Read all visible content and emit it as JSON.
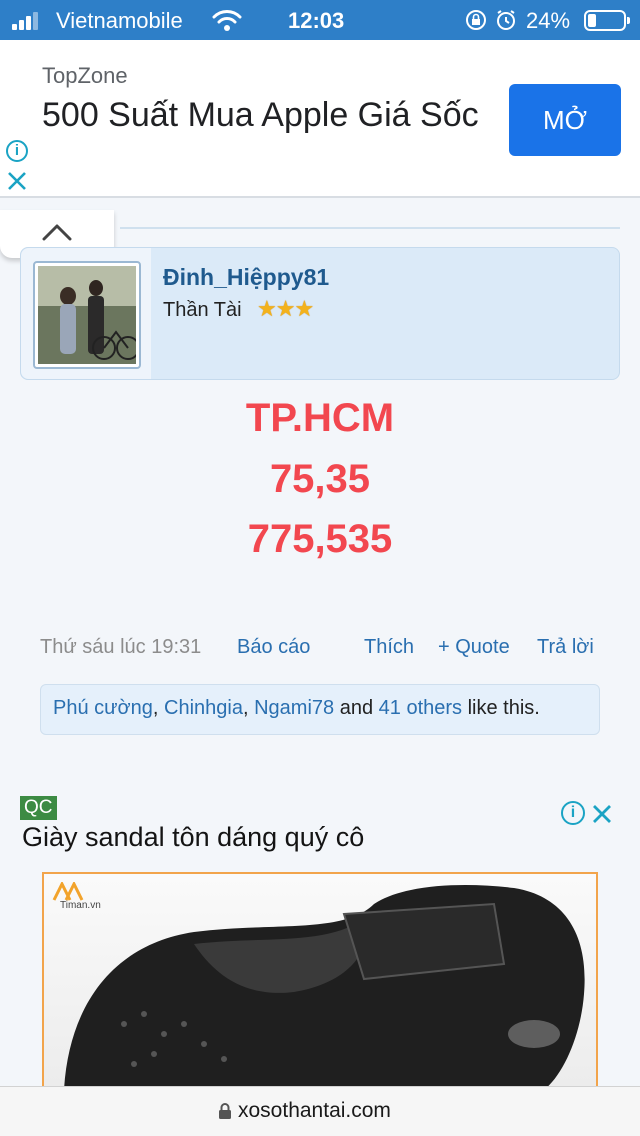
{
  "status_bar": {
    "carrier": "Vietnamobile",
    "time": "12:03",
    "battery": "24%"
  },
  "top_ad": {
    "advertiser": "TopZone",
    "headline": "500 Suất Mua Apple Giá Sốc",
    "cta": "MỞ"
  },
  "user": {
    "username": "Đinh_Hiệppy81",
    "rank": "Thần Tài",
    "stars": "★★★"
  },
  "post": {
    "lines": [
      "TP.HCM",
      "75,35",
      "775,535"
    ]
  },
  "post_actions": {
    "date": "Thứ sáu lúc 19:31",
    "report": "Báo cáo",
    "like": "Thích",
    "quote": "+ Quote",
    "reply": "Trả lời"
  },
  "likes": {
    "user1": "Phú cường",
    "user2": "Chinhgia",
    "user3": "Ngami78",
    "and_text": "and",
    "others": "41 others",
    "suffix": "like this."
  },
  "second_ad": {
    "badge": "QC",
    "title": "Giày sandal tôn dáng quý cô",
    "logo_text": "Timan.vn"
  },
  "url_bar": {
    "url": "xosothantai.com"
  },
  "colors": {
    "status_bar": "#2e7fc8",
    "cta_blue": "#1a73e8",
    "post_red": "#f2474f",
    "link_blue": "#2a6fb0"
  }
}
